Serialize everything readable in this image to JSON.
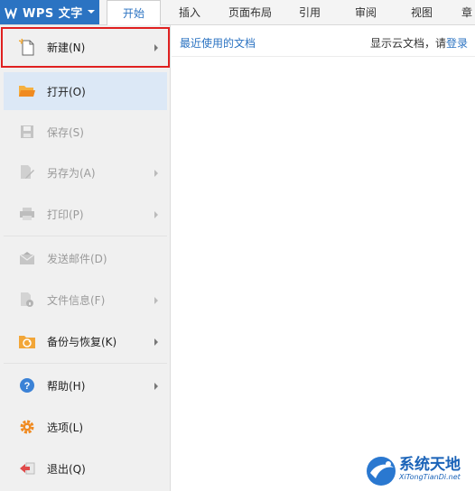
{
  "app": {
    "title": "WPS 文字"
  },
  "tabs": [
    {
      "label": "开始"
    },
    {
      "label": "插入"
    },
    {
      "label": "页面布局"
    },
    {
      "label": "引用"
    },
    {
      "label": "审阅"
    },
    {
      "label": "视图"
    },
    {
      "label": "章"
    }
  ],
  "menu": {
    "items": [
      {
        "label": "新建(N)",
        "icon": "new-doc-icon"
      },
      {
        "label": "打开(O)",
        "icon": "folder-open-icon"
      },
      {
        "label": "保存(S)",
        "icon": "save-icon"
      },
      {
        "label": "另存为(A)",
        "icon": "save-as-icon"
      },
      {
        "label": "打印(P)",
        "icon": "print-icon"
      },
      {
        "label": "发送邮件(D)",
        "icon": "mail-icon"
      },
      {
        "label": "文件信息(F)",
        "icon": "file-info-icon"
      },
      {
        "label": "备份与恢复(K)",
        "icon": "backup-restore-icon"
      },
      {
        "label": "帮助(H)",
        "icon": "help-icon"
      },
      {
        "label": "选项(L)",
        "icon": "gear-icon"
      },
      {
        "label": "退出(Q)",
        "icon": "exit-icon"
      }
    ]
  },
  "recent": {
    "title": "最近使用的文档"
  },
  "cloud": {
    "prefix": "显示云文档，请",
    "link": "登录"
  },
  "watermark": {
    "text": "系统天地",
    "sub": "XiTongTianDi.net"
  },
  "colors": {
    "accent": "#2b73c2",
    "highlight": "#e02020"
  }
}
